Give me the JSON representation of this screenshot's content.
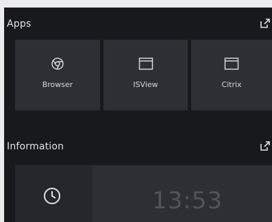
{
  "apps": {
    "title": "Apps",
    "popout_icon": "external-link-icon",
    "tiles": [
      {
        "label": "Browser",
        "icon": "chrome-icon"
      },
      {
        "label": "ISView",
        "icon": "window-icon"
      },
      {
        "label": "Citrix",
        "icon": "window-icon"
      }
    ]
  },
  "information": {
    "title": "Information",
    "popout_icon": "external-link-icon",
    "clock_icon": "clock-icon",
    "time": "13:53"
  },
  "colors": {
    "page_background": "#ececec",
    "panel_background": "#17191c",
    "tile_background": "#2c3034",
    "text": "#e2e4e6"
  }
}
